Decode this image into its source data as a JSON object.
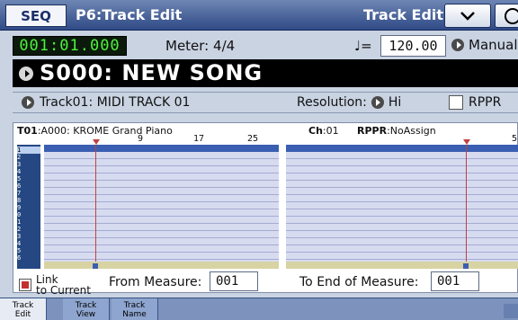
{
  "header": {
    "mode": "SEQ",
    "page_title": "P6:Track Edit",
    "page_label": "Track Edit"
  },
  "status": {
    "location": "001:01.000",
    "meter_label": "Meter:",
    "meter_value": "4/4",
    "tempo_symbol": "♩=",
    "tempo_value": "120.00",
    "tempo_mode": "Manual"
  },
  "song": {
    "name": "S000: NEW SONG"
  },
  "track": {
    "selector": "Track01: MIDI TRACK 01",
    "resolution_label": "Resolution:",
    "resolution_value": "Hi",
    "rppr_label": "RPPR"
  },
  "panel": {
    "track_id": "T01",
    "program": ":A000: KROME Grand Piano",
    "ch_label": "Ch",
    "ch_value": ":01",
    "rppr_label": "RPPR",
    "rppr_value": ":NoAssign",
    "ruler_labels_left": [
      "9",
      "17",
      "25"
    ],
    "ruler_labels_right": [
      "5"
    ],
    "tracks": [
      "1",
      "2",
      "3",
      "4",
      "5",
      "6",
      "7",
      "8",
      "9",
      "0",
      "1",
      "2",
      "3",
      "4",
      "5",
      "6"
    ],
    "link_label_1": "Link",
    "link_label_2": "to Current",
    "from_label": "From Measure:",
    "from_value": "001",
    "to_label": "To End of Measure:",
    "to_value": "001"
  },
  "tabs": [
    {
      "line1": "Track",
      "line2": "Edit",
      "active": true
    },
    {
      "line1": "Track",
      "line2": "View",
      "active": false
    },
    {
      "line1": "Track",
      "line2": "Name",
      "active": false
    }
  ],
  "icons": {
    "menu": "chevron-down-icon",
    "lock": "lock-icon",
    "popup": "popup-arrow-icon"
  },
  "colors": {
    "header": "#2f4a86",
    "locator_text": "#4ff23c",
    "grid_fill": "#d7dbf0",
    "playhead": "#c0413e",
    "link_check": "#c23030"
  }
}
